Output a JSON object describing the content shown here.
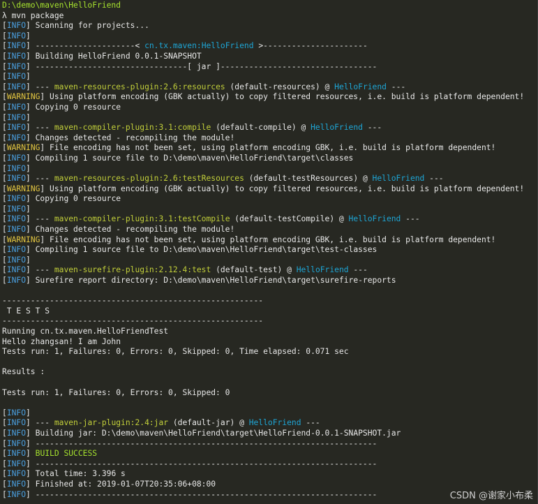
{
  "colors": {
    "text": "#e8e8e8",
    "info": "#4a9fe0",
    "warning": "#e2c541",
    "plugin": "#c2cf3a",
    "project": "#1ea6d6",
    "path": "#a6e22e",
    "success": "#a6e22e"
  },
  "terminal": {
    "lines": [
      [
        {
          "t": "D:\\demo\\maven\\HelloFriend",
          "c": "path"
        }
      ],
      [
        {
          "t": "λ mvn package",
          "c": "text"
        }
      ],
      [
        {
          "t": "[",
          "c": "text"
        },
        {
          "t": "INFO",
          "c": "info"
        },
        {
          "t": "] Scanning for projects...",
          "c": "text"
        }
      ],
      [
        {
          "t": "[",
          "c": "text"
        },
        {
          "t": "INFO",
          "c": "info"
        },
        {
          "t": "]",
          "c": "text"
        }
      ],
      [
        {
          "t": "[",
          "c": "text"
        },
        {
          "t": "INFO",
          "c": "info"
        },
        {
          "t": "] ---------------------< ",
          "c": "text"
        },
        {
          "t": "cn.tx.maven:HelloFriend",
          "c": "project"
        },
        {
          "t": " >----------------------",
          "c": "text"
        }
      ],
      [
        {
          "t": "[",
          "c": "text"
        },
        {
          "t": "INFO",
          "c": "info"
        },
        {
          "t": "] Building HelloFriend 0.0.1-SNAPSHOT",
          "c": "text"
        }
      ],
      [
        {
          "t": "[",
          "c": "text"
        },
        {
          "t": "INFO",
          "c": "info"
        },
        {
          "t": "] --------------------------------[ jar ]---------------------------------",
          "c": "text"
        }
      ],
      [
        {
          "t": "[",
          "c": "text"
        },
        {
          "t": "INFO",
          "c": "info"
        },
        {
          "t": "]",
          "c": "text"
        }
      ],
      [
        {
          "t": "[",
          "c": "text"
        },
        {
          "t": "INFO",
          "c": "info"
        },
        {
          "t": "] --- ",
          "c": "text"
        },
        {
          "t": "maven-resources-plugin:2.6:resources",
          "c": "plugin"
        },
        {
          "t": " (default-resources) @ ",
          "c": "text"
        },
        {
          "t": "HelloFriend",
          "c": "project"
        },
        {
          "t": " ---",
          "c": "text"
        }
      ],
      [
        {
          "t": "[",
          "c": "text"
        },
        {
          "t": "WARNING",
          "c": "warning"
        },
        {
          "t": "] Using platform encoding (GBK actually) to copy filtered resources, i.e. build is platform dependent!",
          "c": "text"
        }
      ],
      [
        {
          "t": "[",
          "c": "text"
        },
        {
          "t": "INFO",
          "c": "info"
        },
        {
          "t": "] Copying 0 resource",
          "c": "text"
        }
      ],
      [
        {
          "t": "[",
          "c": "text"
        },
        {
          "t": "INFO",
          "c": "info"
        },
        {
          "t": "]",
          "c": "text"
        }
      ],
      [
        {
          "t": "[",
          "c": "text"
        },
        {
          "t": "INFO",
          "c": "info"
        },
        {
          "t": "] --- ",
          "c": "text"
        },
        {
          "t": "maven-compiler-plugin:3.1:compile",
          "c": "plugin"
        },
        {
          "t": " (default-compile) @ ",
          "c": "text"
        },
        {
          "t": "HelloFriend",
          "c": "project"
        },
        {
          "t": " ---",
          "c": "text"
        }
      ],
      [
        {
          "t": "[",
          "c": "text"
        },
        {
          "t": "INFO",
          "c": "info"
        },
        {
          "t": "] Changes detected - recompiling the module!",
          "c": "text"
        }
      ],
      [
        {
          "t": "[",
          "c": "text"
        },
        {
          "t": "WARNING",
          "c": "warning"
        },
        {
          "t": "] File encoding has not been set, using platform encoding GBK, i.e. build is platform dependent!",
          "c": "text"
        }
      ],
      [
        {
          "t": "[",
          "c": "text"
        },
        {
          "t": "INFO",
          "c": "info"
        },
        {
          "t": "] Compiling 1 source file to D:\\demo\\maven\\HelloFriend\\target\\classes",
          "c": "text"
        }
      ],
      [
        {
          "t": "[",
          "c": "text"
        },
        {
          "t": "INFO",
          "c": "info"
        },
        {
          "t": "]",
          "c": "text"
        }
      ],
      [
        {
          "t": "[",
          "c": "text"
        },
        {
          "t": "INFO",
          "c": "info"
        },
        {
          "t": "] --- ",
          "c": "text"
        },
        {
          "t": "maven-resources-plugin:2.6:testResources",
          "c": "plugin"
        },
        {
          "t": " (default-testResources) @ ",
          "c": "text"
        },
        {
          "t": "HelloFriend",
          "c": "project"
        },
        {
          "t": " ---",
          "c": "text"
        }
      ],
      [
        {
          "t": "[",
          "c": "text"
        },
        {
          "t": "WARNING",
          "c": "warning"
        },
        {
          "t": "] Using platform encoding (GBK actually) to copy filtered resources, i.e. build is platform dependent!",
          "c": "text"
        }
      ],
      [
        {
          "t": "[",
          "c": "text"
        },
        {
          "t": "INFO",
          "c": "info"
        },
        {
          "t": "] Copying 0 resource",
          "c": "text"
        }
      ],
      [
        {
          "t": "[",
          "c": "text"
        },
        {
          "t": "INFO",
          "c": "info"
        },
        {
          "t": "]",
          "c": "text"
        }
      ],
      [
        {
          "t": "[",
          "c": "text"
        },
        {
          "t": "INFO",
          "c": "info"
        },
        {
          "t": "] --- ",
          "c": "text"
        },
        {
          "t": "maven-compiler-plugin:3.1:testCompile",
          "c": "plugin"
        },
        {
          "t": " (default-testCompile) @ ",
          "c": "text"
        },
        {
          "t": "HelloFriend",
          "c": "project"
        },
        {
          "t": " ---",
          "c": "text"
        }
      ],
      [
        {
          "t": "[",
          "c": "text"
        },
        {
          "t": "INFO",
          "c": "info"
        },
        {
          "t": "] Changes detected - recompiling the module!",
          "c": "text"
        }
      ],
      [
        {
          "t": "[",
          "c": "text"
        },
        {
          "t": "WARNING",
          "c": "warning"
        },
        {
          "t": "] File encoding has not been set, using platform encoding GBK, i.e. build is platform dependent!",
          "c": "text"
        }
      ],
      [
        {
          "t": "[",
          "c": "text"
        },
        {
          "t": "INFO",
          "c": "info"
        },
        {
          "t": "] Compiling 1 source file to D:\\demo\\maven\\HelloFriend\\target\\test-classes",
          "c": "text"
        }
      ],
      [
        {
          "t": "[",
          "c": "text"
        },
        {
          "t": "INFO",
          "c": "info"
        },
        {
          "t": "]",
          "c": "text"
        }
      ],
      [
        {
          "t": "[",
          "c": "text"
        },
        {
          "t": "INFO",
          "c": "info"
        },
        {
          "t": "] --- ",
          "c": "text"
        },
        {
          "t": "maven-surefire-plugin:2.12.4:test",
          "c": "plugin"
        },
        {
          "t": " (default-test) @ ",
          "c": "text"
        },
        {
          "t": "HelloFriend",
          "c": "project"
        },
        {
          "t": " ---",
          "c": "text"
        }
      ],
      [
        {
          "t": "[",
          "c": "text"
        },
        {
          "t": "INFO",
          "c": "info"
        },
        {
          "t": "] Surefire report directory: D:\\demo\\maven\\HelloFriend\\target\\surefire-reports",
          "c": "text"
        }
      ],
      [],
      [
        {
          "t": "-------------------------------------------------------",
          "c": "text"
        }
      ],
      [
        {
          "t": " T E S T S",
          "c": "text"
        }
      ],
      [
        {
          "t": "-------------------------------------------------------",
          "c": "text"
        }
      ],
      [
        {
          "t": "Running cn.tx.maven.HelloFriendTest",
          "c": "text"
        }
      ],
      [
        {
          "t": "Hello zhangsan! I am John",
          "c": "text"
        }
      ],
      [
        {
          "t": "Tests run: 1, Failures: 0, Errors: 0, Skipped: 0, Time elapsed: 0.071 sec",
          "c": "text"
        }
      ],
      [],
      [
        {
          "t": "Results :",
          "c": "text"
        }
      ],
      [],
      [
        {
          "t": "Tests run: 1, Failures: 0, Errors: 0, Skipped: 0",
          "c": "text"
        }
      ],
      [],
      [
        {
          "t": "[",
          "c": "text"
        },
        {
          "t": "INFO",
          "c": "info"
        },
        {
          "t": "]",
          "c": "text"
        }
      ],
      [
        {
          "t": "[",
          "c": "text"
        },
        {
          "t": "INFO",
          "c": "info"
        },
        {
          "t": "] --- ",
          "c": "text"
        },
        {
          "t": "maven-jar-plugin:2.4:jar",
          "c": "plugin"
        },
        {
          "t": " (default-jar) @ ",
          "c": "text"
        },
        {
          "t": "HelloFriend",
          "c": "project"
        },
        {
          "t": " ---",
          "c": "text"
        }
      ],
      [
        {
          "t": "[",
          "c": "text"
        },
        {
          "t": "INFO",
          "c": "info"
        },
        {
          "t": "] Building jar: D:\\demo\\maven\\HelloFriend\\target\\HelloFriend-0.0.1-SNAPSHOT.jar",
          "c": "text"
        }
      ],
      [
        {
          "t": "[",
          "c": "text"
        },
        {
          "t": "INFO",
          "c": "info"
        },
        {
          "t": "] ------------------------------------------------------------------------",
          "c": "text"
        }
      ],
      [
        {
          "t": "[",
          "c": "text"
        },
        {
          "t": "INFO",
          "c": "info"
        },
        {
          "t": "] ",
          "c": "text"
        },
        {
          "t": "BUILD SUCCESS",
          "c": "success"
        }
      ],
      [
        {
          "t": "[",
          "c": "text"
        },
        {
          "t": "INFO",
          "c": "info"
        },
        {
          "t": "] ------------------------------------------------------------------------",
          "c": "text"
        }
      ],
      [
        {
          "t": "[",
          "c": "text"
        },
        {
          "t": "INFO",
          "c": "info"
        },
        {
          "t": "] Total time: 3.396 s",
          "c": "text"
        }
      ],
      [
        {
          "t": "[",
          "c": "text"
        },
        {
          "t": "INFO",
          "c": "info"
        },
        {
          "t": "] Finished at: 2019-01-07T20:35:06+08:00",
          "c": "text"
        }
      ],
      [
        {
          "t": "[",
          "c": "text"
        },
        {
          "t": "INFO",
          "c": "info"
        },
        {
          "t": "] ------------------------------------------------------------------------",
          "c": "text"
        }
      ]
    ]
  },
  "watermark": {
    "text": "CSDN @谢家小布柔"
  }
}
